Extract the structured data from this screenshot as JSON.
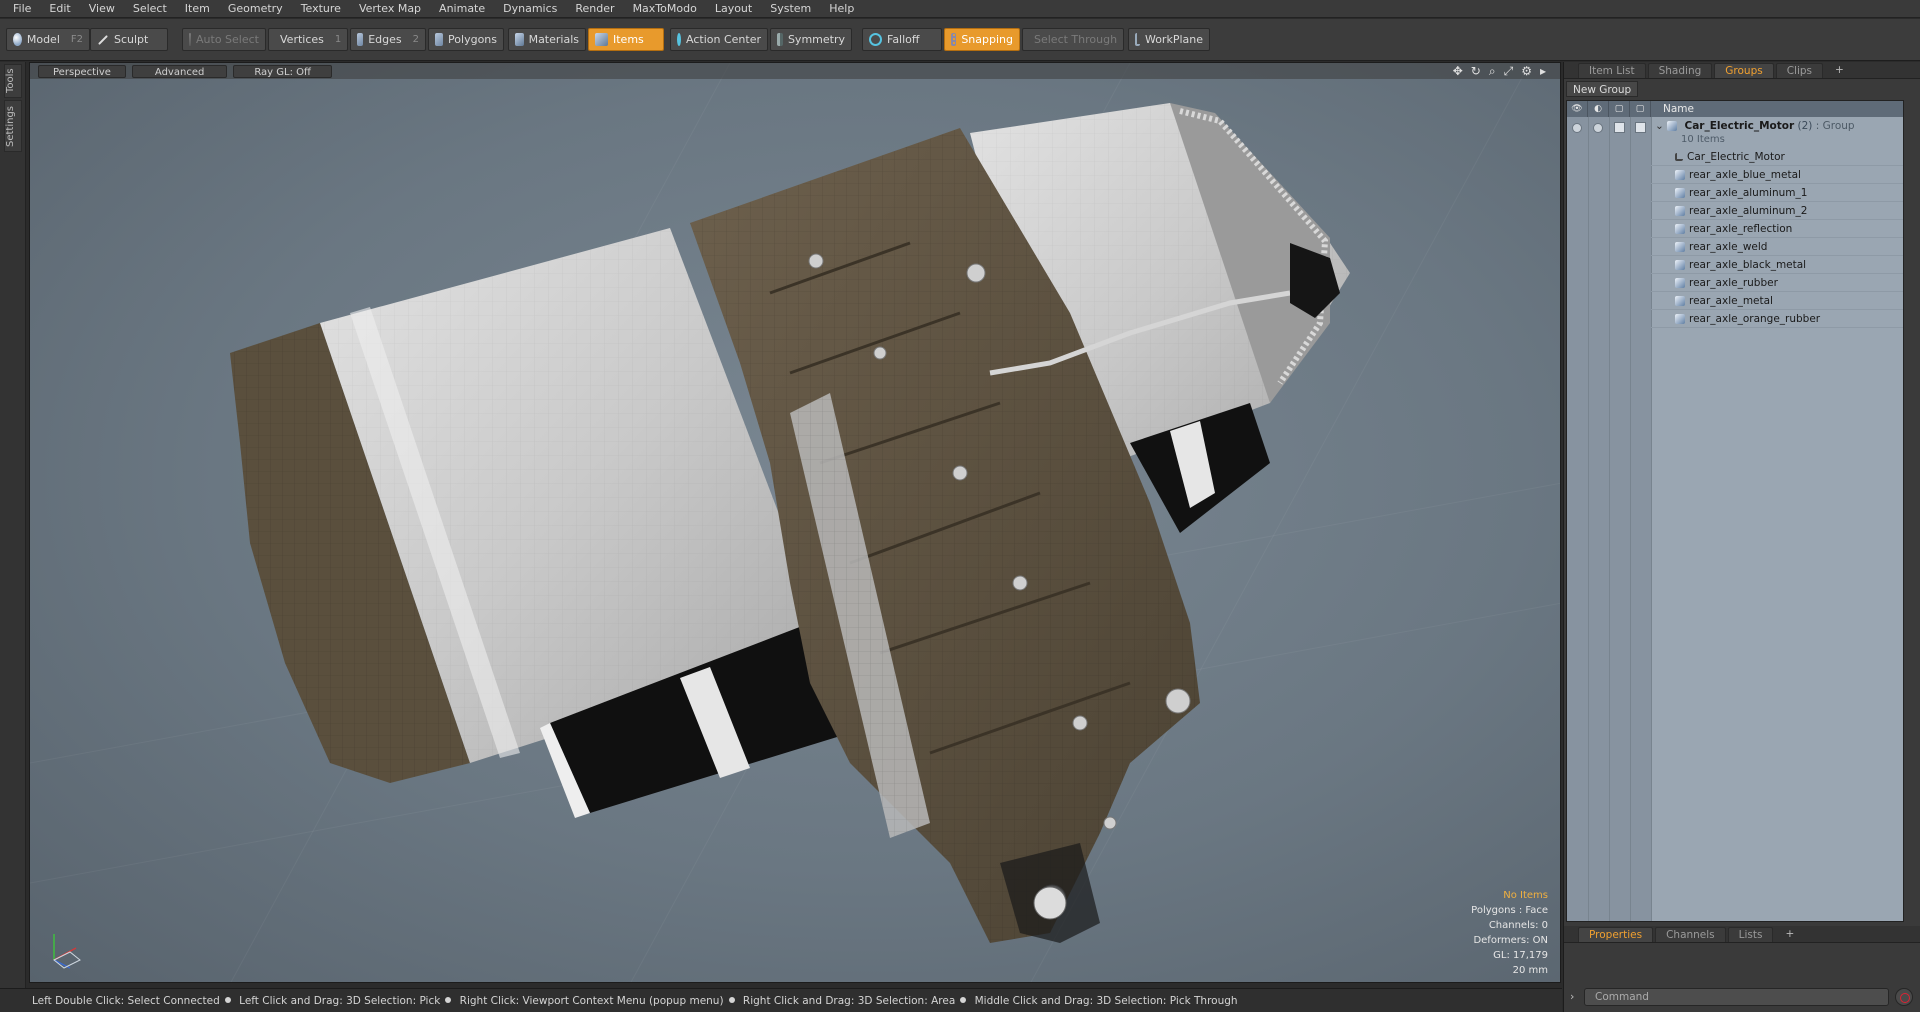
{
  "menu": [
    "File",
    "Edit",
    "View",
    "Select",
    "Item",
    "Geometry",
    "Texture",
    "Vertex Map",
    "Animate",
    "Dynamics",
    "Render",
    "MaxToModo",
    "Layout",
    "System",
    "Help"
  ],
  "toolbar": {
    "model": "Model",
    "model_key": "F2",
    "sculpt": "Sculpt",
    "auto_select": "Auto Select",
    "vertices": "Vertices",
    "vertices_key": "1",
    "edges": "Edges",
    "edges_key": "2",
    "polygons": "Polygons",
    "materials": "Materials",
    "items": "Items",
    "action_center": "Action Center",
    "symmetry": "Symmetry",
    "falloff": "Falloff",
    "snapping": "Snapping",
    "select_through": "Select Through",
    "workplane": "WorkPlane"
  },
  "left_tabs": {
    "tools": "Tools",
    "settings": "Settings"
  },
  "viewport": {
    "view_mode": "Perspective",
    "shading": "Advanced",
    "raygl": "Ray GL: Off",
    "info": {
      "selection": "No Items",
      "polygons": "Polygons : Face",
      "channels": "Channels: 0",
      "deformers": "Deformers: ON",
      "gl": "GL: 17,179",
      "scale": "20 mm"
    }
  },
  "statusbar": {
    "hint1": "Left Double Click: Select Connected",
    "hint2": "Left Click and Drag: 3D Selection: Pick",
    "hint3": "Right Click: Viewport Context Menu (popup menu)",
    "hint4": "Right Click and Drag: 3D Selection: Area",
    "hint5": "Middle Click and Drag: 3D Selection: Pick Through"
  },
  "right_panel": {
    "tabs": [
      "Item List",
      "Shading",
      "Groups",
      "Clips"
    ],
    "active_tab": "Groups",
    "new_group": "New Group",
    "name_header": "Name",
    "group": {
      "name": "Car_Electric_Motor",
      "count": "(2)",
      "type": ": Group",
      "items_label": "10 Items"
    },
    "items": [
      "Car_Electric_Motor",
      "rear_axle_blue_metal",
      "rear_axle_aluminum_1",
      "rear_axle_aluminum_2",
      "rear_axle_reflection",
      "rear_axle_weld",
      "rear_axle_black_metal",
      "rear_axle_rubber",
      "rear_axle_metal",
      "rear_axle_orange_rubber"
    ],
    "bottom_tabs": [
      "Properties",
      "Channels",
      "Lists"
    ],
    "command_placeholder": "Command"
  },
  "colors": {
    "accent": "#e89a2c",
    "viewport_bg": "#6a7782",
    "list_bg": "#9aa6b2"
  }
}
